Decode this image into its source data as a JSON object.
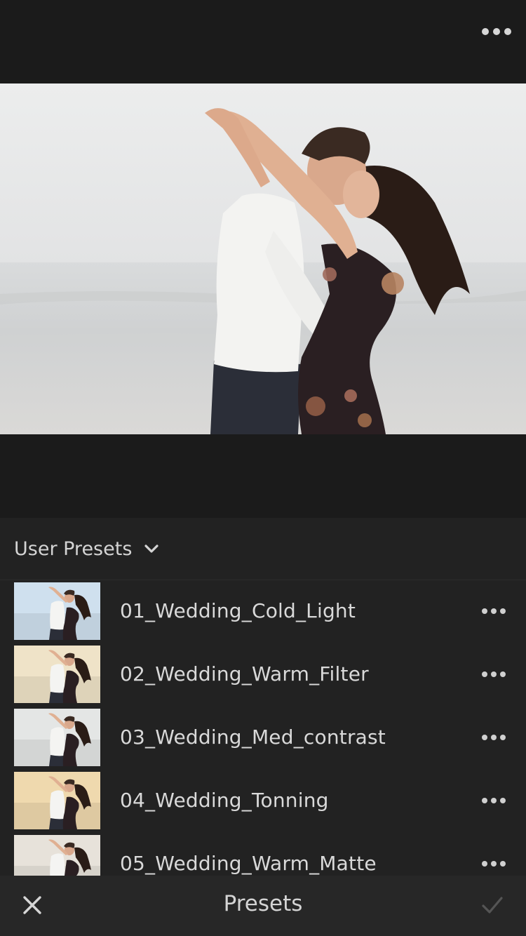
{
  "top_bar": {
    "more_icon": "more-horizontal-icon"
  },
  "photo": {
    "description_icon": "photo-preview",
    "colors": {
      "sky": "#e8e9ea",
      "sea": "#d6d8d9",
      "shirt": "#f4f4f2",
      "pants": "#2b2e38",
      "dress": "#2a1f1f",
      "hair": "#2a1c16"
    }
  },
  "presets_panel": {
    "group_title": "User Presets",
    "group_chevron_icon": "chevron-down-icon",
    "items": [
      {
        "name": "01_Wedding_Cold_Light",
        "tint": "#cfe0ee"
      },
      {
        "name": "02_Wedding_Warm_Filter",
        "tint": "#efe3c8"
      },
      {
        "name": "03_Wedding_Med_contrast",
        "tint": "#e4e6e5"
      },
      {
        "name": "04_Wedding_Tonning",
        "tint": "#efd9ae"
      },
      {
        "name": "05_Wedding_Warm_Matte",
        "tint": "#e7e2da"
      }
    ],
    "row_more_icon": "more-horizontal-icon"
  },
  "bottom_bar": {
    "close_icon": "close-icon",
    "title": "Presets",
    "confirm_icon": "checkmark-icon"
  }
}
